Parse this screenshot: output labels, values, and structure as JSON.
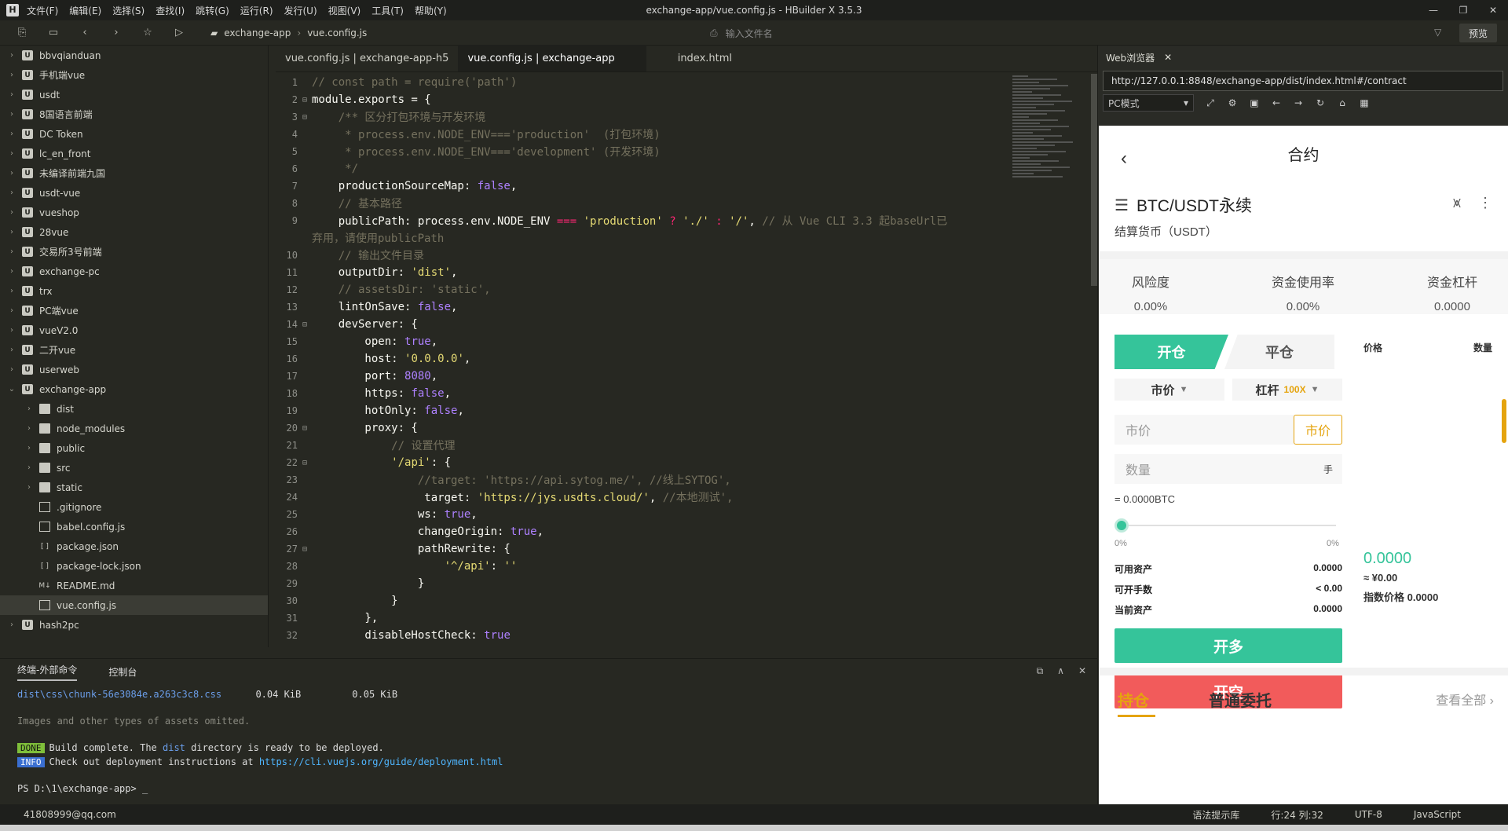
{
  "window": {
    "title": "exchange-app/vue.config.js - HBuilder X 3.5.3",
    "logo": "H",
    "menu": [
      "文件(F)",
      "编辑(E)",
      "选择(S)",
      "查找(I)",
      "跳转(G)",
      "运行(R)",
      "发行(U)",
      "视图(V)",
      "工具(T)",
      "帮助(Y)"
    ]
  },
  "toolbar": {
    "breadcrumb": [
      "exchange-app",
      "vue.config.js"
    ],
    "file_search_placeholder": "输入文件名",
    "preview_label": "预览"
  },
  "sidebar": {
    "items": [
      {
        "label": "bbvqianduan",
        "type": "project",
        "chev": "›"
      },
      {
        "label": "手机端vue",
        "type": "project",
        "chev": "›"
      },
      {
        "label": "usdt",
        "type": "project",
        "chev": "›"
      },
      {
        "label": "8国语言前端",
        "type": "project",
        "chev": "›"
      },
      {
        "label": "DC Token",
        "type": "project",
        "chev": "›"
      },
      {
        "label": "lc_en_front",
        "type": "project",
        "chev": "›"
      },
      {
        "label": "未编译前端九国",
        "type": "project",
        "chev": "›"
      },
      {
        "label": "usdt-vue",
        "type": "project",
        "chev": "›"
      },
      {
        "label": "vueshop",
        "type": "project",
        "chev": "›"
      },
      {
        "label": "28vue",
        "type": "project",
        "chev": "›"
      },
      {
        "label": "交易所3号前端",
        "type": "project",
        "chev": "›"
      },
      {
        "label": "exchange-pc",
        "type": "project",
        "chev": "›"
      },
      {
        "label": "trx",
        "type": "project",
        "chev": "›"
      },
      {
        "label": "PC端vue",
        "type": "project",
        "chev": "›"
      },
      {
        "label": "vueV2.0",
        "type": "project",
        "chev": "›"
      },
      {
        "label": "二开vue",
        "type": "project",
        "chev": "›"
      },
      {
        "label": "userweb",
        "type": "project",
        "chev": "›"
      },
      {
        "label": "exchange-app",
        "type": "project",
        "chev": "⌄"
      },
      {
        "label": "dist",
        "type": "folder",
        "chev": "›",
        "indent": 1
      },
      {
        "label": "node_modules",
        "type": "folder",
        "chev": "›",
        "indent": 1
      },
      {
        "label": "public",
        "type": "folder",
        "chev": "›",
        "indent": 1
      },
      {
        "label": "src",
        "type": "folder",
        "chev": "›",
        "indent": 1
      },
      {
        "label": "static",
        "type": "folder",
        "chev": "›",
        "indent": 1
      },
      {
        "label": ".gitignore",
        "type": "file",
        "chev": "",
        "indent": 1
      },
      {
        "label": "babel.config.js",
        "type": "file",
        "chev": "",
        "indent": 1
      },
      {
        "label": "package.json",
        "type": "json",
        "chev": "",
        "indent": 1
      },
      {
        "label": "package-lock.json",
        "type": "json",
        "chev": "",
        "indent": 1
      },
      {
        "label": "README.md",
        "type": "md",
        "chev": "",
        "indent": 1
      },
      {
        "label": "vue.config.js",
        "type": "file",
        "chev": "",
        "indent": 1,
        "selected": true
      },
      {
        "label": "hash2pc",
        "type": "project",
        "chev": "›"
      }
    ]
  },
  "editor": {
    "tabs": [
      "vue.config.js | exchange-app-h5",
      "vue.config.js | exchange-app",
      "index.html"
    ],
    "active_tab": 1,
    "lines": [
      {
        "n": "1",
        "fold": "",
        "html": "<span class='c'>// const path = require('path')</span>"
      },
      {
        "n": "2",
        "fold": "⊟",
        "html": "module.exports = {"
      },
      {
        "n": "3",
        "fold": "⊟",
        "html": "    <span class='c'>/** 区分打包环境与开发环境</span>"
      },
      {
        "n": "4",
        "fold": "",
        "html": "<span class='c'>     * process.env.NODE_ENV==='production'  (打包环境)</span>"
      },
      {
        "n": "5",
        "fold": "",
        "html": "<span class='c'>     * process.env.NODE_ENV==='development' (开发环境)</span>"
      },
      {
        "n": "6",
        "fold": "",
        "html": "<span class='c'>     */</span>"
      },
      {
        "n": "7",
        "fold": "",
        "html": "    productionSourceMap: <span class='n'>false</span>,"
      },
      {
        "n": "8",
        "fold": "",
        "html": "    <span class='c'>// 基本路径</span>"
      },
      {
        "n": "9",
        "fold": "",
        "html": "    publicPath: process.env.NODE_ENV <span class='k'>===</span> <span class='s'>'production'</span> <span class='k'>?</span> <span class='s'>'./'</span> <span class='k'>:</span> <span class='s'>'/'</span>, <span class='c'>// 从 Vue CLI 3.3 起baseUrl已</span>"
      },
      {
        "n": "",
        "fold": "",
        "html": "<span class='c'>弃用，请使用publicPath</span>"
      },
      {
        "n": "10",
        "fold": "",
        "html": "    <span class='c'>// 输出文件目录</span>"
      },
      {
        "n": "11",
        "fold": "",
        "html": "    outputDir: <span class='s'>'dist'</span>,"
      },
      {
        "n": "12",
        "fold": "",
        "html": "    <span class='c'>// assetsDir: 'static',</span>"
      },
      {
        "n": "13",
        "fold": "",
        "html": "    lintOnSave: <span class='n'>false</span>,"
      },
      {
        "n": "14",
        "fold": "⊟",
        "html": "    devServer: {"
      },
      {
        "n": "15",
        "fold": "",
        "html": "        open: <span class='n'>true</span>,"
      },
      {
        "n": "16",
        "fold": "",
        "html": "        host: <span class='s'>'0.0.0.0'</span>,"
      },
      {
        "n": "17",
        "fold": "",
        "html": "        port: <span class='n'>8080</span>,"
      },
      {
        "n": "18",
        "fold": "",
        "html": "        https: <span class='n'>false</span>,"
      },
      {
        "n": "19",
        "fold": "",
        "html": "        hotOnly: <span class='n'>false</span>,"
      },
      {
        "n": "20",
        "fold": "⊟",
        "html": "        proxy: {"
      },
      {
        "n": "21",
        "fold": "",
        "html": "            <span class='c'>// 设置代理</span>"
      },
      {
        "n": "22",
        "fold": "⊟",
        "html": "            <span class='s'>'/api'</span>: {"
      },
      {
        "n": "23",
        "fold": "",
        "html": "                <span class='c'>//target: 'https://api.sytog.me/', //线上SYTOG',</span>"
      },
      {
        "n": "24",
        "fold": "",
        "html": "                 target: <span class='s'>'https://jys.usdts.cloud/'</span>, <span class='c'>//本地测试',</span>"
      },
      {
        "n": "25",
        "fold": "",
        "html": "                ws: <span class='n'>true</span>,"
      },
      {
        "n": "26",
        "fold": "",
        "html": "                changeOrigin: <span class='n'>true</span>,"
      },
      {
        "n": "27",
        "fold": "⊟",
        "html": "                pathRewrite: {"
      },
      {
        "n": "28",
        "fold": "",
        "html": "                    <span class='s'>'^/api'</span>: <span class='s'>''</span>"
      },
      {
        "n": "29",
        "fold": "",
        "html": "                }"
      },
      {
        "n": "30",
        "fold": "",
        "html": "            }"
      },
      {
        "n": "31",
        "fold": "",
        "html": "        },"
      },
      {
        "n": "32",
        "fold": "",
        "html": "        disableHostCheck: <span class='n'>true</span>"
      }
    ]
  },
  "browser": {
    "tab_label": "Web浏览器",
    "url": "http://127.0.0.1:8848/exchange-app/dist/index.html#/contract",
    "mode": "PC模式"
  },
  "mobile": {
    "header_title": "合约",
    "pair": "BTC/USDT永续",
    "settle": "结算货币（USDT）",
    "stats": [
      {
        "label": "风险度",
        "value": "0.00%"
      },
      {
        "label": "资金使用率",
        "value": "0.00%"
      },
      {
        "label": "资金杠杆",
        "value": "0.0000"
      }
    ],
    "open_tab": "开仓",
    "close_tab": "平仓",
    "order_type": "市价",
    "leverage_label": "杠杆",
    "leverage_value": "100X",
    "price_placeholder": "市价",
    "price_mode": "市价",
    "qty_placeholder": "数量",
    "qty_unit": "手",
    "equiv": "= 0.0000BTC",
    "slider_min": "0%",
    "slider_max": "0%",
    "kv": [
      {
        "k": "可用资产",
        "v": "0.0000"
      },
      {
        "k": "可开手数",
        "v": "< 0.00"
      },
      {
        "k": "当前资产",
        "v": "0.0000"
      }
    ],
    "btn_long": "开多",
    "btn_short": "开空",
    "orderbook": {
      "price_label": "价格",
      "qty_label": "数量",
      "last_price": "0.0000",
      "cny": "≈ ¥0.00",
      "index": "指数价格 0.0000"
    },
    "bottom_tabs": [
      "持仓",
      "普通委托"
    ],
    "view_all": "查看全部"
  },
  "terminal": {
    "tabs": [
      "终端-外部命令",
      "控制台"
    ],
    "css_file": "dist\\css\\chunk-56e3084e.a263c3c8.css",
    "size1": "0.04 KiB",
    "size2": "0.05 KiB",
    "omitted": "Images and other types of assets omitted.",
    "done_badge": "DONE",
    "done_text_a": "Build complete. The ",
    "done_text_b": "dist",
    "done_text_c": " directory is ready to be deployed.",
    "info_badge": "INFO",
    "info_text": "Check out deployment instructions at ",
    "info_link": "https://cli.vuejs.org/guide/deployment.html",
    "prompt": "PS D:\\1\\exchange-app> _"
  },
  "statusbar": {
    "user": "41808999@qq.com",
    "hint": "语法提示库",
    "position": "行:24  列:32",
    "encoding": "UTF-8",
    "language": "JavaScript"
  }
}
